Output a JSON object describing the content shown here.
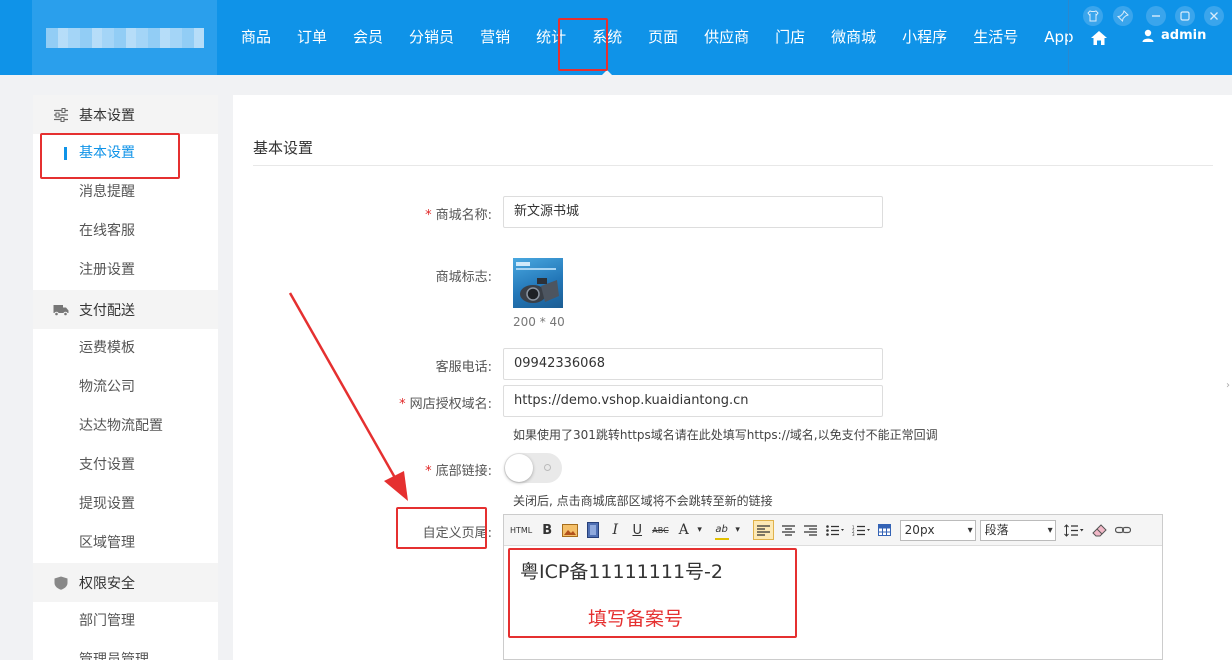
{
  "header": {
    "nav": [
      {
        "label": "商品",
        "name": "nav-goods"
      },
      {
        "label": "订单",
        "name": "nav-orders"
      },
      {
        "label": "会员",
        "name": "nav-members"
      },
      {
        "label": "分销员",
        "name": "nav-distributors"
      },
      {
        "label": "营销",
        "name": "nav-marketing"
      },
      {
        "label": "统计",
        "name": "nav-stats"
      },
      {
        "label": "系统",
        "name": "nav-system"
      },
      {
        "label": "页面",
        "name": "nav-pages"
      },
      {
        "label": "供应商",
        "name": "nav-suppliers"
      },
      {
        "label": "门店",
        "name": "nav-stores"
      },
      {
        "label": "微商城",
        "name": "nav-micromall"
      },
      {
        "label": "小程序",
        "name": "nav-miniprogram"
      },
      {
        "label": "生活号",
        "name": "nav-lifeaccount"
      },
      {
        "label": "App",
        "name": "nav-app"
      }
    ],
    "active_nav": "系统",
    "user": "admin",
    "icons": [
      "home-icon",
      "user-icon",
      "shirt-icon",
      "pin-icon",
      "minimize-icon",
      "maximize-icon",
      "close-icon"
    ]
  },
  "sidebar": {
    "sections": [
      {
        "title": "基本设置",
        "icon": "sliders-icon",
        "items": [
          "基本设置",
          "消息提醒",
          "在线客服",
          "注册设置"
        ]
      },
      {
        "title": "支付配送",
        "icon": "truck-icon",
        "items": [
          "运费模板",
          "物流公司",
          "达达物流配置",
          "支付设置",
          "提现设置",
          "区域管理"
        ]
      },
      {
        "title": "权限安全",
        "icon": "shield-icon",
        "items": [
          "部门管理",
          "管理员管理"
        ]
      }
    ],
    "active_item": "基本设置"
  },
  "form": {
    "title": "基本设置",
    "shop_name": {
      "label": "商城名称:",
      "value": "新文源书城"
    },
    "shop_logo": {
      "label": "商城标志:",
      "size_hint": "200 * 40"
    },
    "phone": {
      "label": "客服电话:",
      "value": "09942336068"
    },
    "domain": {
      "label": "网店授权域名:",
      "value": "https://demo.vshop.kuaidiantong.cn",
      "hint": "如果使用了301跳转https域名请在此处填写https://域名,以免支付不能正常回调"
    },
    "footer_link": {
      "label": "底部链接:",
      "enabled": false,
      "hint": "关闭后, 点击商城底部区域将不会跳转至新的链接"
    },
    "custom_footer": {
      "label": "自定义页尾:",
      "content": "粤ICP备11111111号-2"
    }
  },
  "editor": {
    "html_label": "HTML",
    "bold": "B",
    "italic": "I",
    "underline": "U",
    "strike": "ABC",
    "font_color": "A",
    "highlight": "ab",
    "font_size": "20px",
    "paragraph": "段落"
  },
  "annotation": {
    "note": "填写备案号",
    "color": "#e53030"
  },
  "colors": {
    "topbar": "#0f93e8",
    "accent": "#0f93e8",
    "required": "#e02525"
  }
}
